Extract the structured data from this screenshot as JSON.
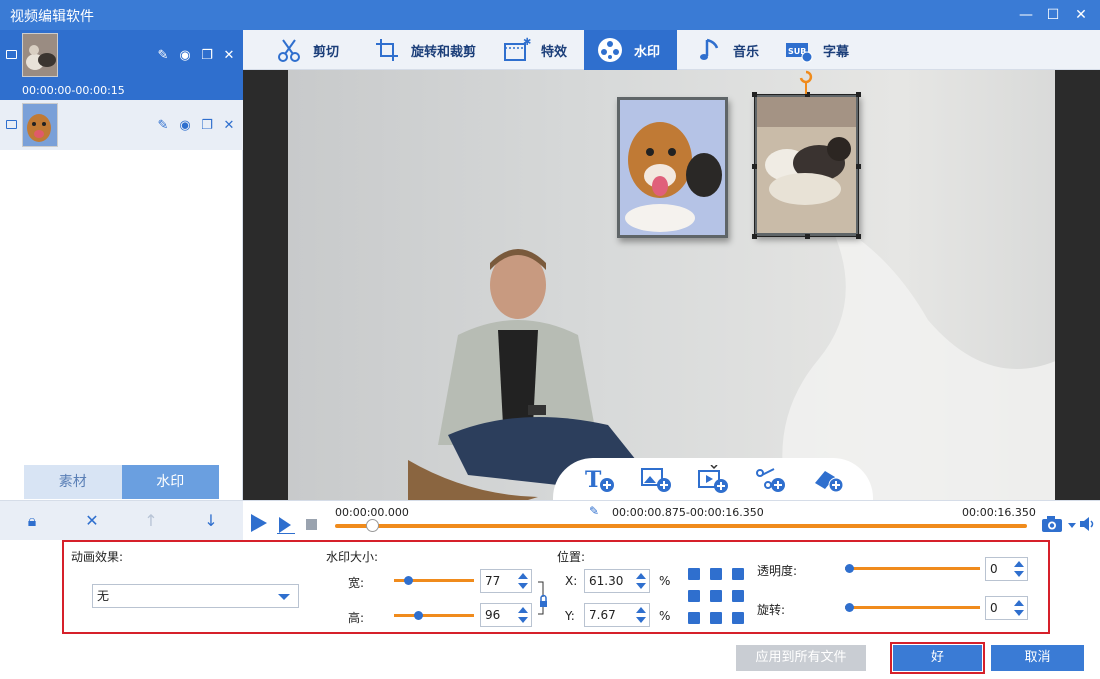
{
  "window": {
    "title": "视频编辑软件",
    "minimize": "—",
    "maximize": "☐",
    "close": "✕"
  },
  "files": [
    {
      "time_range": "00:00:00-00:00:15",
      "type": "video"
    },
    {
      "time_range": "",
      "type": "image"
    }
  ],
  "left_tabs": {
    "materials": "素材",
    "watermark": "水印"
  },
  "toolbar": {
    "cut": "剪切",
    "rotate_crop": "旋转和裁剪",
    "effects": "特效",
    "watermark": "水印",
    "music": "音乐",
    "subtitles": "字幕",
    "active": "watermark"
  },
  "timeline": {
    "start": "00:00:00.000",
    "range": "00:00:00.875-00:00:16.350",
    "end": "00:00:16.350",
    "position": 0.053
  },
  "settings": {
    "animation_label": "动画效果:",
    "animation_value": "无",
    "size_label": "水印大小:",
    "width_label": "宽:",
    "width_value": "77",
    "height_label": "高:",
    "height_value": "96",
    "position_label": "位置:",
    "x_label": "X:",
    "x_value": "61.30",
    "y_label": "Y:",
    "y_value": "7.67",
    "percent": "%",
    "opacity_label": "透明度:",
    "opacity_value": "0",
    "rotation_label": "旋转:",
    "rotation_value": "0"
  },
  "buttons": {
    "apply_all": "应用到所有文件",
    "ok": "好",
    "cancel": "取消"
  },
  "colors": {
    "accent": "#2f6fce",
    "titlebar": "#3a7bd5",
    "slider": "#f08b1c",
    "highlight": "#d6202a"
  }
}
